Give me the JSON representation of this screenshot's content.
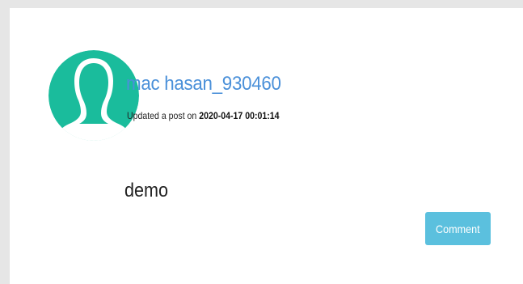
{
  "post": {
    "author_name": "mac hasan_930460",
    "action_text": "Updated a post on",
    "timestamp": "2020-04-17 00:01:14",
    "content": "demo",
    "comment_label": "Comment"
  },
  "avatar": {
    "icon": "user-silhouette-icon",
    "color": "#1abc9c",
    "background": "#ffffff"
  },
  "colors": {
    "link": "#4a90d9",
    "button": "#5bc0de",
    "page_background": "#e6e6e6"
  }
}
